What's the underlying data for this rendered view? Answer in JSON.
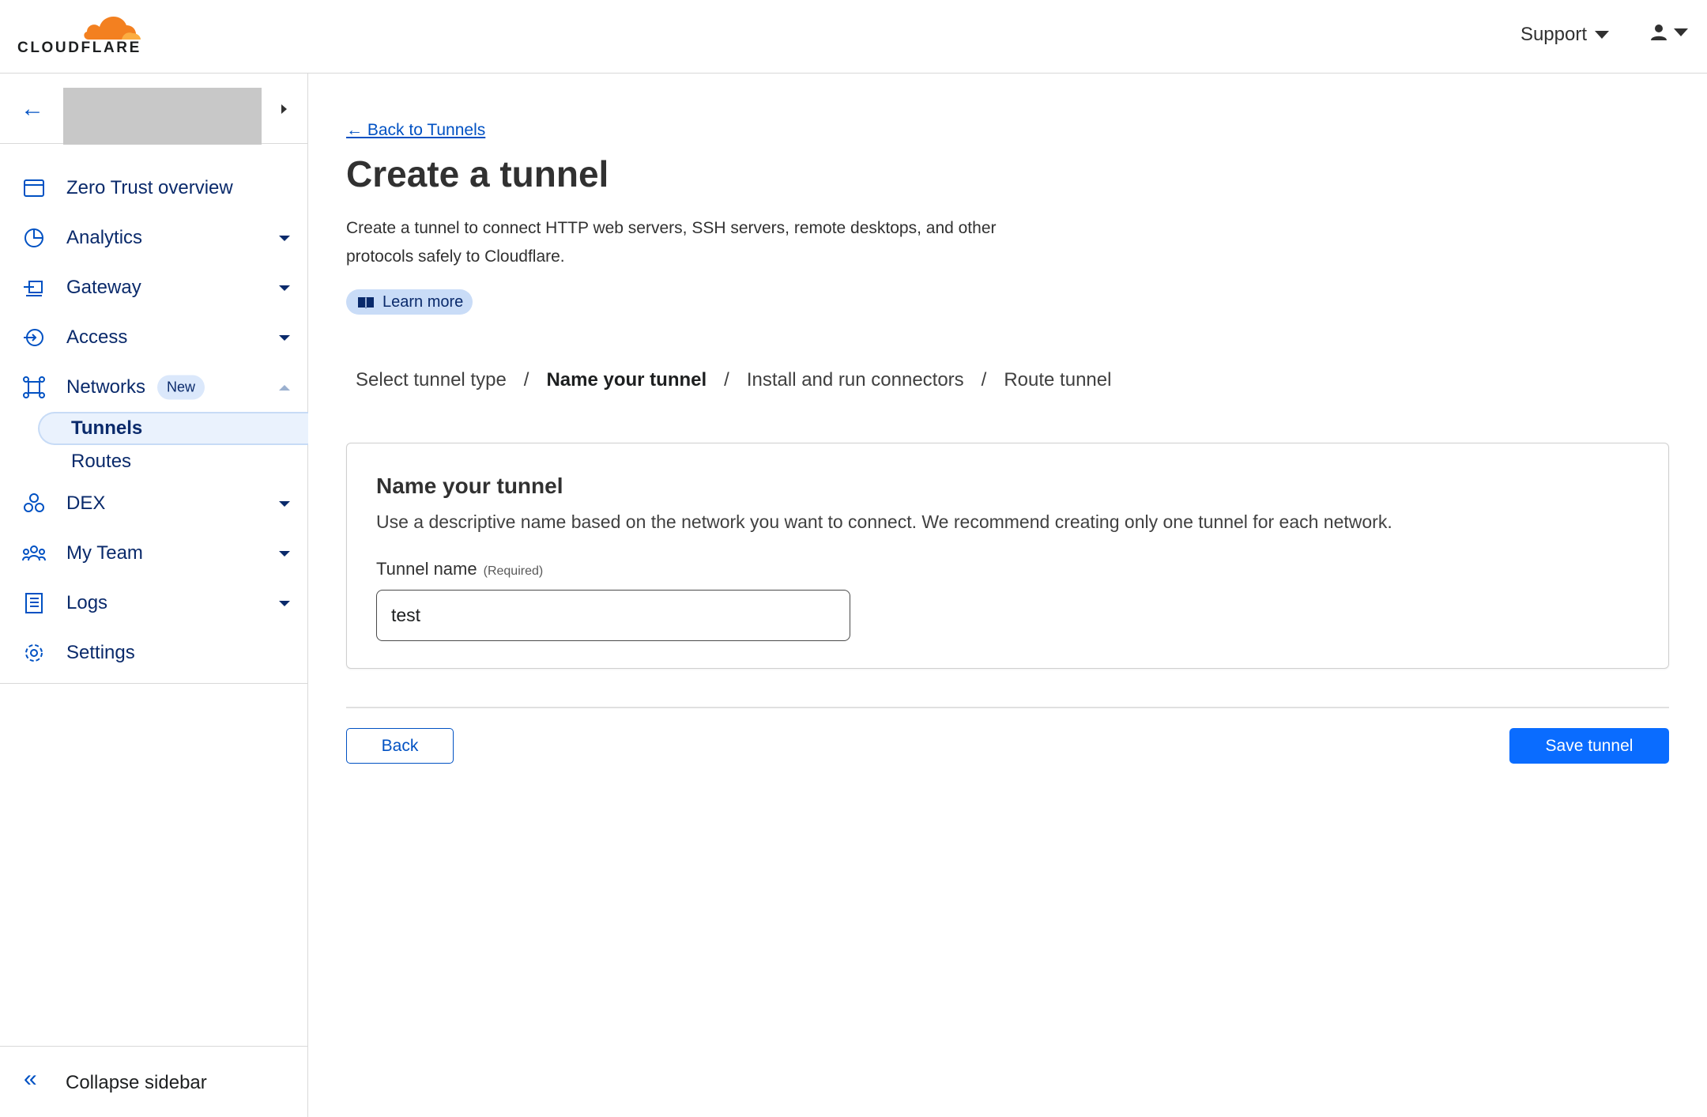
{
  "brand": {
    "name": "CLOUDFLARE",
    "accent": "#f38020",
    "primary": "#0051c3"
  },
  "header": {
    "support_label": "Support",
    "user_icon": "user-icon"
  },
  "sidebar": {
    "account_back_icon": "arrow-left-icon",
    "items": [
      {
        "label": "Zero Trust overview",
        "icon": "window-icon",
        "has_caret": false
      },
      {
        "label": "Analytics",
        "icon": "pie-chart-icon",
        "has_caret": true
      },
      {
        "label": "Gateway",
        "icon": "gateway-icon",
        "has_caret": true
      },
      {
        "label": "Access",
        "icon": "access-icon",
        "has_caret": true
      },
      {
        "label": "Networks",
        "icon": "network-icon",
        "has_caret": true,
        "badge": "New",
        "expanded": true
      },
      {
        "label": "DEX",
        "icon": "dex-icon",
        "has_caret": true
      },
      {
        "label": "My Team",
        "icon": "team-icon",
        "has_caret": true
      },
      {
        "label": "Logs",
        "icon": "logs-icon",
        "has_caret": true
      },
      {
        "label": "Settings",
        "icon": "gear-icon",
        "has_caret": false
      }
    ],
    "subitems": [
      {
        "label": "Tunnels",
        "active": true
      },
      {
        "label": "Routes",
        "active": false
      }
    ],
    "collapse_label": "Collapse sidebar"
  },
  "main": {
    "back_link": "← Back to Tunnels",
    "title": "Create a tunnel",
    "description": "Create a tunnel to connect HTTP web servers, SSH servers, remote desktops, and other protocols safely to Cloudflare.",
    "learn_more": "Learn more",
    "steps": [
      {
        "label": "Select tunnel type",
        "current": false
      },
      {
        "label": "Name your tunnel",
        "current": true
      },
      {
        "label": "Install and run connectors",
        "current": false
      },
      {
        "label": "Route tunnel",
        "current": false
      }
    ],
    "step_separator": "/",
    "card": {
      "title": "Name your tunnel",
      "description": "Use a descriptive name based on the network you want to connect. We recommend creating only one tunnel for each network.",
      "field_label": "Tunnel name",
      "field_required": "(Required)",
      "field_value": "test"
    },
    "back_button": "Back",
    "save_button": "Save tunnel"
  }
}
